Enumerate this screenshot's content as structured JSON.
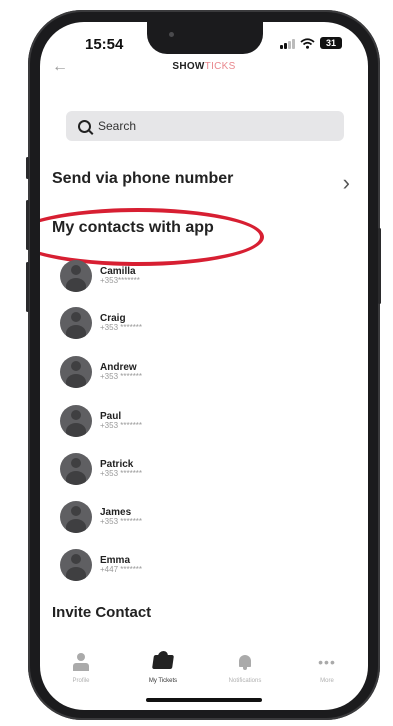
{
  "status": {
    "time": "15:54",
    "battery": "31"
  },
  "header": {
    "brand_bold": "SHOW",
    "brand_light": "TICKS"
  },
  "search": {
    "label": "Search"
  },
  "send_via_phone": {
    "label": "Send via phone number"
  },
  "contacts_section": {
    "title": "My contacts with app"
  },
  "contacts": [
    {
      "name": "Camilla",
      "phone": "+353*******"
    },
    {
      "name": "Craig",
      "phone": "+353 *******"
    },
    {
      "name": "Andrew",
      "phone": "+353 *******"
    },
    {
      "name": "Paul",
      "phone": "+353 *******"
    },
    {
      "name": "Patrick",
      "phone": "+353 *******"
    },
    {
      "name": "James",
      "phone": "+353 *******"
    },
    {
      "name": "Emma",
      "phone": "+447 *******"
    }
  ],
  "invite": {
    "label": "Invite Contact"
  },
  "tabbar": {
    "items": [
      {
        "label": "Profile",
        "icon": "person-icon"
      },
      {
        "label": "My Tickets",
        "icon": "ticket-icon"
      },
      {
        "label": "Notifications",
        "icon": "bell-icon"
      },
      {
        "label": "More",
        "icon": "more-icon"
      }
    ],
    "active": "My Tickets"
  },
  "colors": {
    "highlight": "#d71f32",
    "brand_accent": "#e9878d"
  }
}
